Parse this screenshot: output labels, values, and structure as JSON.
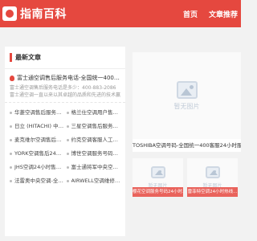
{
  "site": {
    "logo_text": "指南百科"
  },
  "nav": {
    "home": "首页",
    "articles": "文章推荐"
  },
  "latest": {
    "title": "最新文章",
    "featured": {
      "title": "富士通空调售后服务电话-全国统一400客服24小时服务热线实时...",
      "desc": "富士通空调售后服务电话是多少：400-883-2086富士通空调一直以来以其卓越的品质和先进的技术赢得了市场广泛的赞誉..."
    },
    "items": [
      "华菱空调售后服务指南及...",
      "格兰仕空调用户售后服务中...",
      "日立 (HITACHI) 中央空...",
      "三星空调售后服务号码-人...",
      "麦克维尔空调售后服务：专...",
      "约克空调客服人工号码(...",
      "YORK空调售后24小时热...",
      "博世空调服务号码24小时...",
      "JHS空调24小时售后全国...",
      "富士通将军中央空调服务...",
      "法雷奥中央空调-全国售...",
      "AIRWELL空调维修热线24..."
    ]
  },
  "featured_card": {
    "placeholder": "暂无图片",
    "caption": "TOSHIBA空调号码-全国统一400客服24小时服..."
  },
  "small_cards": [
    {
      "placeholder": "暂无图片",
      "caption": "樱花空调服务号码24小时..."
    },
    {
      "placeholder": "暂无图片",
      "caption": "雷菲特空调24小时热线..."
    }
  ]
}
